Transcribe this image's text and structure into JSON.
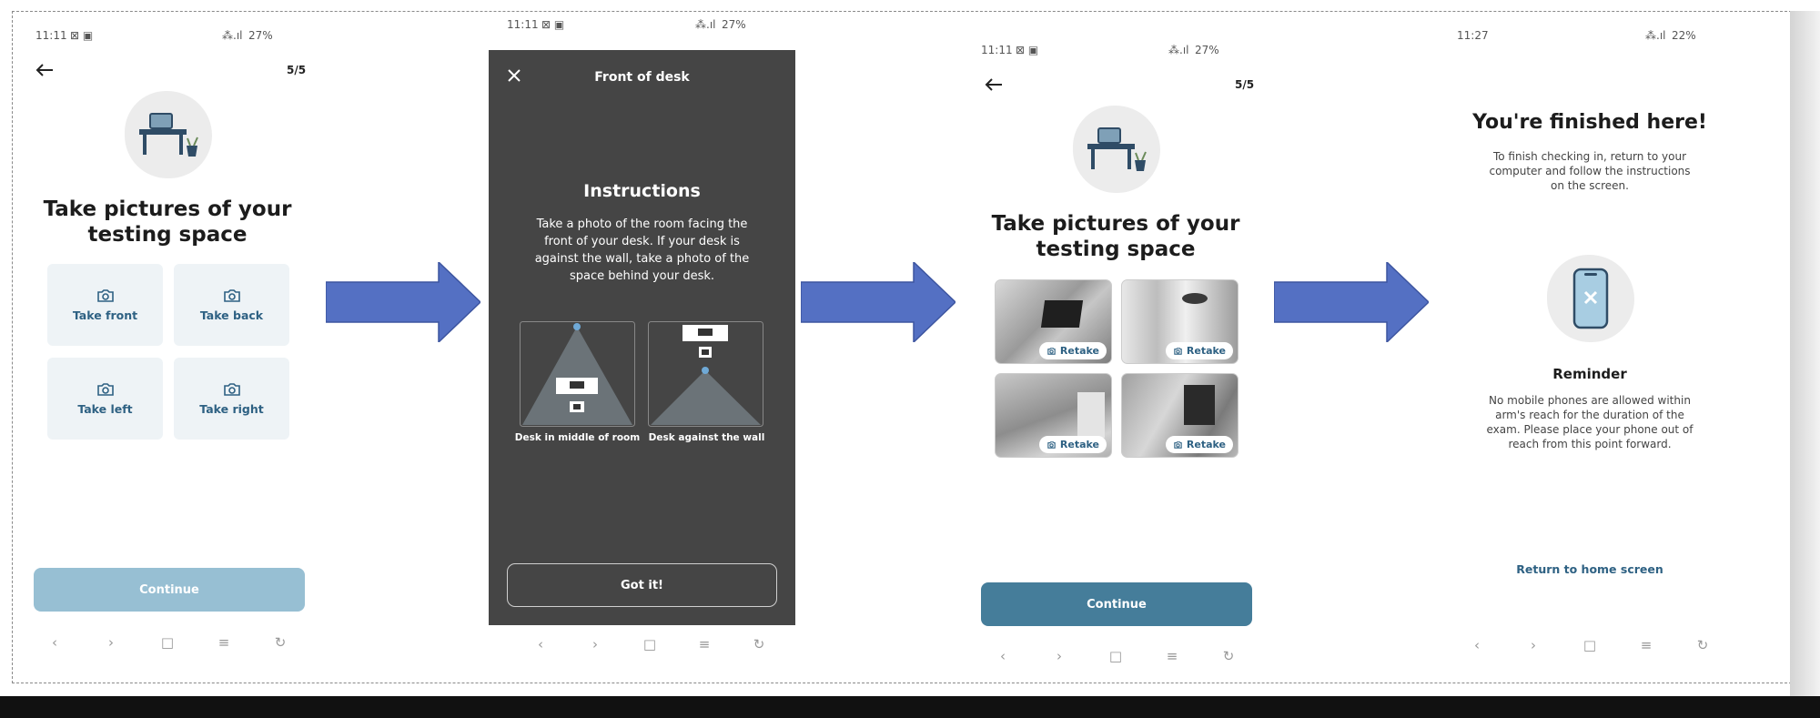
{
  "screens": [
    {
      "status_time": "11:11",
      "status_right": "27%",
      "step": "5/5",
      "title": "Take pictures of your testing space",
      "tiles": [
        "Take front",
        "Take back",
        "Take left",
        "Take right"
      ],
      "continue_label": "Continue"
    },
    {
      "status_time": "11:11",
      "status_right": "27%",
      "header_title": "Front of desk",
      "instructions_title": "Instructions",
      "instructions_body": "Take a photo of the room facing the front of your desk. If your desk is against the wall, take a photo of the space behind your desk.",
      "diagram_left_label": "Desk in middle of room",
      "diagram_right_label": "Desk against the wall",
      "got_it_label": "Got it!"
    },
    {
      "status_time": "11:11",
      "status_right": "27%",
      "step": "5/5",
      "title": "Take pictures of your testing space",
      "retake_label": "Retake",
      "continue_label": "Continue"
    },
    {
      "status_time": "11:27",
      "status_right": "22%",
      "title": "You're finished here!",
      "subtitle": "To finish checking in, return to your computer and follow the instructions on the screen.",
      "reminder_title": "Reminder",
      "reminder_body": "No mobile phones are allowed within arm's reach for the duration of the exam. Please place your phone out of reach from this point forward.",
      "home_link": "Return to home screen"
    }
  ],
  "colors": {
    "accent": "#2e6183",
    "continue_disabled": "#97bfd3",
    "continue_active": "#457d9a",
    "arrow": "#5470c3",
    "dark_screen": "#454545"
  },
  "icons": {
    "back": "left-arrow",
    "close": "x",
    "camera": "camera",
    "retake": "retake-camera",
    "no_phone": "phone-x",
    "nav": [
      "chevron-left",
      "chevron-right",
      "square",
      "menu",
      "refresh"
    ]
  }
}
